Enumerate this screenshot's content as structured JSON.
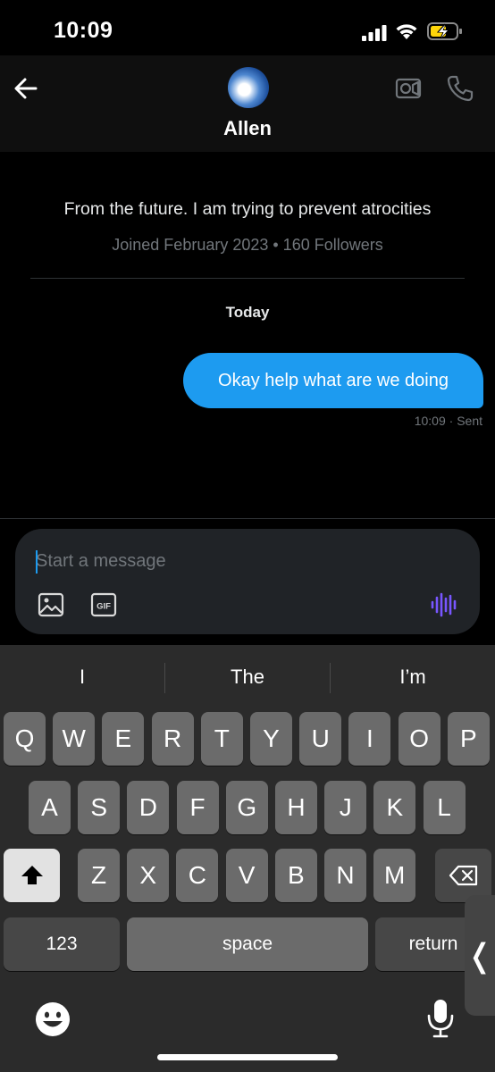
{
  "status_bar": {
    "time": "10:09",
    "signal_icon": "cellular-signal-icon",
    "wifi_icon": "wifi-icon",
    "battery_icon": "battery-charging-icon"
  },
  "header": {
    "back_icon": "arrow-left-icon",
    "contact_name": "Allen",
    "video_icon": "video-camera-icon",
    "phone_icon": "phone-icon"
  },
  "profile": {
    "bio": "From the future. I am trying to prevent atrocities",
    "meta": "Joined February 2023 • 160 Followers"
  },
  "conversation": {
    "date_label": "Today",
    "messages": [
      {
        "text": "Okay help what are we doing",
        "time_status": "10:09 · Sent"
      }
    ]
  },
  "composer": {
    "placeholder": "Start a message",
    "value": "",
    "image_icon": "image-icon",
    "gif_label": "GIF",
    "voice_icon": "voice-waveform-icon"
  },
  "keyboard": {
    "suggestions": [
      "I",
      "The",
      "I’m"
    ],
    "row1": [
      "Q",
      "W",
      "E",
      "R",
      "T",
      "Y",
      "U",
      "I",
      "O",
      "P"
    ],
    "row2": [
      "A",
      "S",
      "D",
      "F",
      "G",
      "H",
      "J",
      "K",
      "L"
    ],
    "row3": [
      "Z",
      "X",
      "C",
      "V",
      "B",
      "N",
      "M"
    ],
    "numbers_label": "123",
    "space_label": "space",
    "return_label": "return",
    "shift_icon": "shift-icon",
    "delete_icon": "backspace-icon",
    "emoji_icon": "emoji-icon",
    "mic_icon": "microphone-icon",
    "side_handle_label": "❬"
  },
  "colors": {
    "accent": "#1d9bf0",
    "voice": "#7856ff",
    "background": "#000000"
  }
}
